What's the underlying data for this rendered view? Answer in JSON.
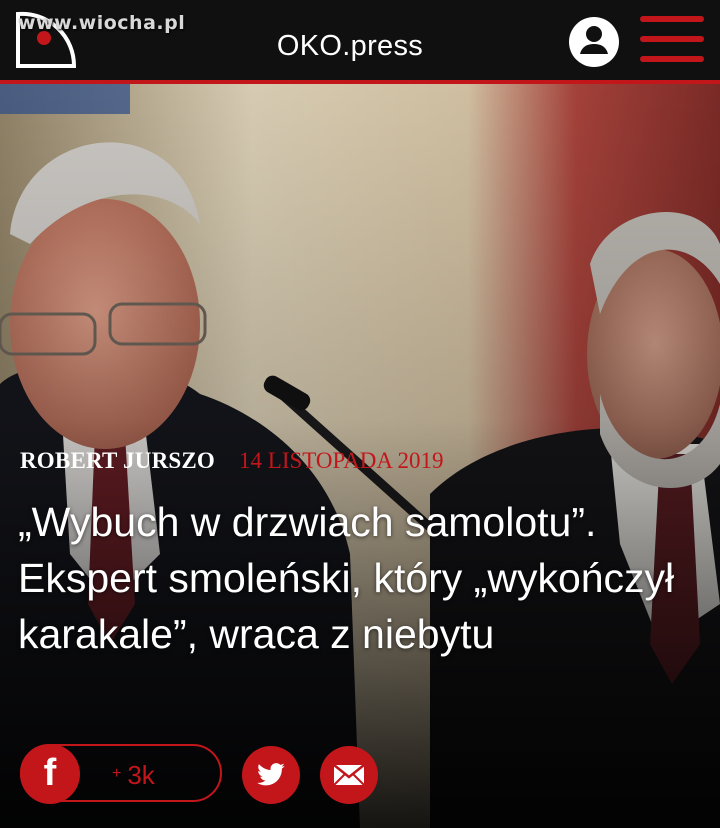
{
  "header": {
    "brand": "OKO.press",
    "watermark": "www.wiocha.pl",
    "accent_color": "#c2161b",
    "icons": [
      "logo-eye-icon",
      "user-icon",
      "hamburger-menu-icon"
    ]
  },
  "article": {
    "author": "ROBERT JURSZO",
    "date": "14 LISTOPADA 2019",
    "headline": "„Wybuch w drzwiach samolotu”. Ekspert smoleński, który „wykończył karakale”, wraca z niebytu"
  },
  "share": {
    "facebook_letter": "f",
    "count_prefix": "+",
    "count": "3k",
    "icons": [
      "facebook-icon",
      "twitter-icon",
      "email-icon"
    ]
  }
}
